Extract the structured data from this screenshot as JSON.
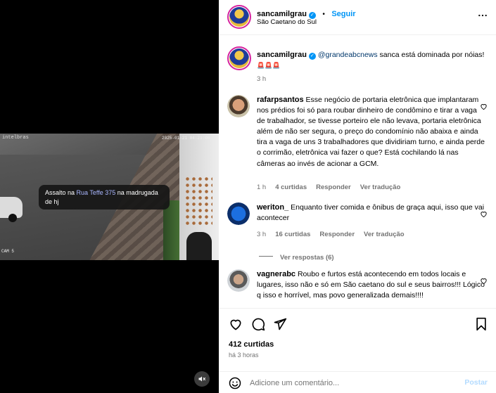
{
  "media": {
    "cam_brand": "intelbras",
    "cam_timestamp": "2025-01-21 04:21:00",
    "cam_channel": "CAM 5",
    "caption_pre": "Assalto na ",
    "caption_highlight": "Rua Teffe 375",
    "caption_post": " na madrugada de hj",
    "mute_icon": "speaker-muted-icon"
  },
  "post": {
    "username": "sancamilgrau",
    "follow_label": "Seguir",
    "separator": "•",
    "location": "São Caetano do Sul",
    "more_icon": "more-horizontal-icon"
  },
  "caption": {
    "username": "sancamilgrau",
    "mention": "@grandeabcnews",
    "text": " sanca está dominada por nóias!",
    "emojis": "🚨🚨🚨",
    "time": "3 h"
  },
  "comments": [
    {
      "username": "rafarpsantos",
      "text": " Esse negócio de portaria eletrônica que implantaram nos prédios foi só para roubar dinheiro de condômino e tirar a vaga de trabalhador, se tivesse porteiro ele não levava, portaria eletrônica além de não ser segura, o preço do condomínio não abaixa e ainda tira a vaga de uns 3 trabalhadores que dividiriam turno, e ainda perde o corrimão, eletrônica vai fazer o que? Está cochilando lá nas câmeras ao invés de acionar a GCM.",
      "time": "1 h",
      "likes": "4 curtidas",
      "reply": "Responder",
      "translate": "Ver tradução"
    },
    {
      "username": "weriton_",
      "text": " Enquanto tiver comida e ônibus de graça aqui, isso que vai acontecer",
      "time": "3 h",
      "likes": "16 curtidas",
      "reply": "Responder",
      "translate": "Ver tradução",
      "view_replies": "Ver respostas (6)"
    },
    {
      "username": "vagnerabc",
      "text": " Roubo e furtos está acontecendo em todos locais e lugares, isso não e só em São caetano do sul e seus bairros!!! Lógico q isso e horrível, mas povo generalizada demais!!!!",
      "time": "",
      "likes": "",
      "reply": "",
      "translate": ""
    }
  ],
  "actions": {
    "like_icon": "heart-icon",
    "comment_icon": "comment-icon",
    "share_icon": "share-icon",
    "save_icon": "bookmark-icon",
    "likes_count": "412 curtidas",
    "posted_ago": "há 3 horas"
  },
  "composer": {
    "emoji_icon": "emoji-icon",
    "placeholder": "Adicione um comentário...",
    "post_label": "Postar"
  },
  "colors": {
    "accent": "#0095f6",
    "muted": "#737373",
    "link": "#00376b"
  }
}
